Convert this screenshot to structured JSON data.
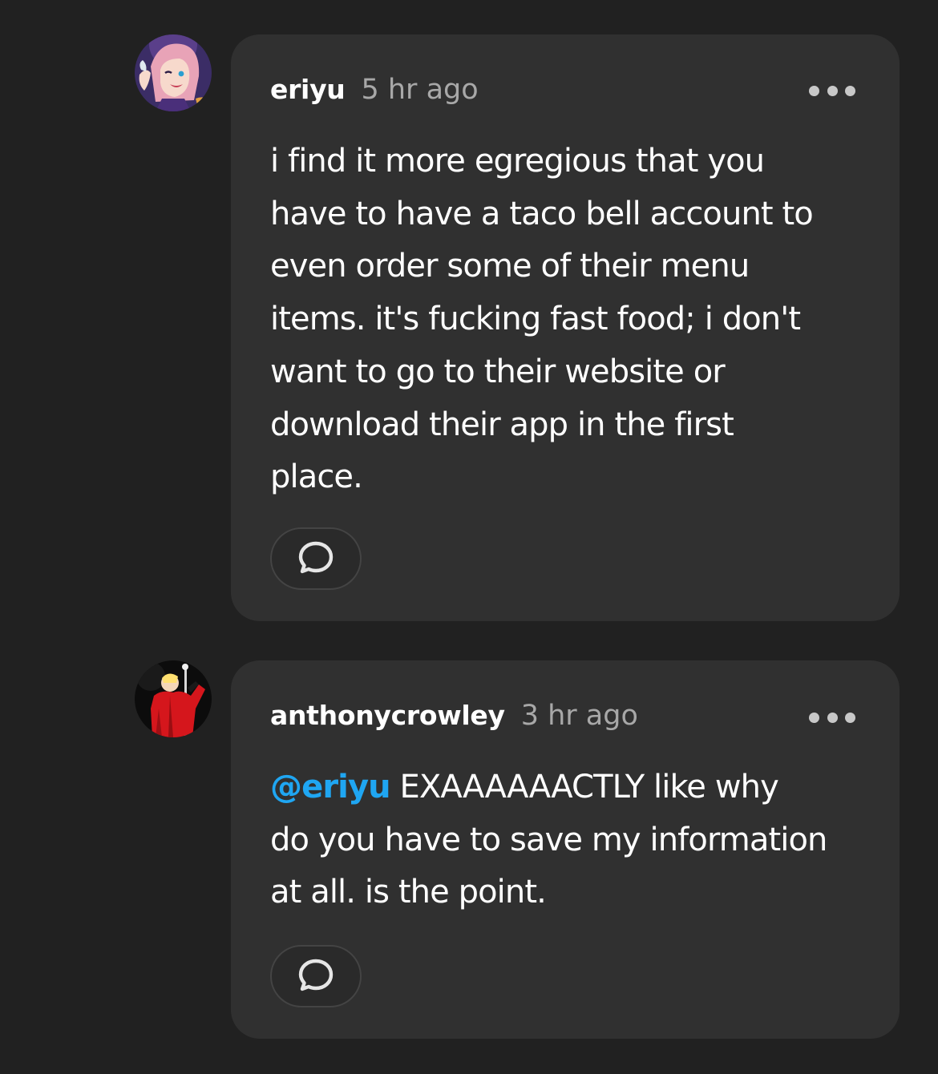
{
  "comments": [
    {
      "username": "eriyu",
      "timestamp": "5 hr ago",
      "avatar_icon": "anime-girl-avatar",
      "mention": "",
      "text_lines": [
        "i find it more egregious that you",
        "have to have a taco bell account to",
        "even order some of their menu",
        "items. it's fucking fast food; i don't",
        "want to go to their website or",
        "download their app in the first",
        "place."
      ],
      "more_icon": "more-horizontal-icon",
      "reply_icon": "reply-bubble-icon"
    },
    {
      "username": "anthonycrowley",
      "timestamp": "3 hr ago",
      "avatar_icon": "red-coat-figure-avatar",
      "mention": "@eriyu",
      "text_first_line_after_mention": " EXAAAAAACTLY like why",
      "text_lines": [
        "do you have to save my information",
        "at all. is the point."
      ],
      "more_icon": "more-horizontal-icon",
      "reply_icon": "reply-bubble-icon"
    }
  ],
  "colors": {
    "background": "#212121",
    "bubble": "#303030",
    "mention": "#1fa6f2",
    "timestamp": "#a8a8a8"
  }
}
